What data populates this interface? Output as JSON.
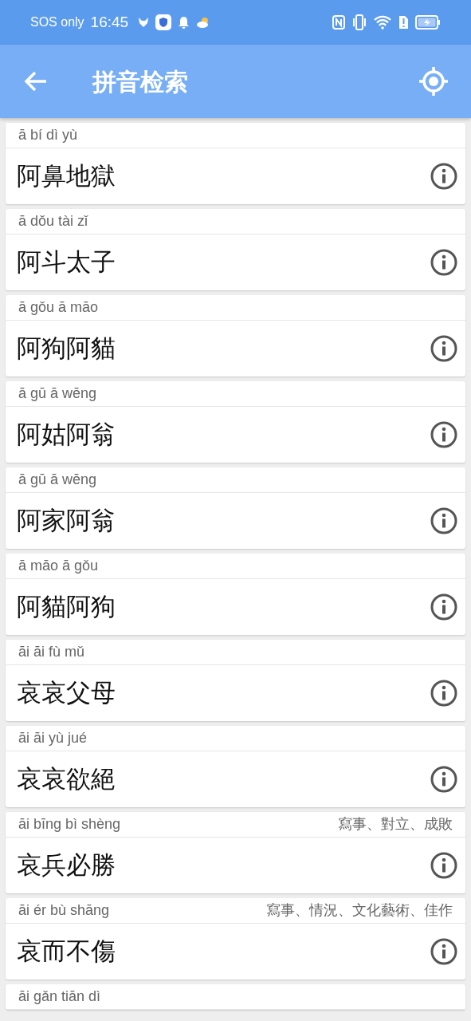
{
  "status_bar": {
    "carrier": "SOS only",
    "time": "16:45"
  },
  "app_bar": {
    "title": "拼音检索"
  },
  "entries": [
    {
      "pinyin": "ā bí dì yù",
      "phrase": "阿鼻地獄"
    },
    {
      "pinyin": "ā dǒu tài zǐ",
      "phrase": "阿斗太子"
    },
    {
      "pinyin": "ā gǒu ā māo",
      "phrase": "阿狗阿貓"
    },
    {
      "pinyin": "ā gū ā wēng",
      "phrase": "阿姑阿翁"
    },
    {
      "pinyin": "ā gū ā wēng",
      "phrase": "阿家阿翁"
    },
    {
      "pinyin": "ā māo ā gǒu",
      "phrase": "阿貓阿狗"
    },
    {
      "pinyin": "āi āi fù mǔ",
      "phrase": "哀哀父母"
    },
    {
      "pinyin": "āi āi yù jué",
      "phrase": "哀哀欲絕"
    },
    {
      "pinyin": "āi bīng bì shèng",
      "tags": "寫事、對立、成敗",
      "phrase": "哀兵必勝"
    },
    {
      "pinyin": "āi ér bù shāng",
      "tags": "寫事、情況、文化藝術、佳作",
      "phrase": "哀而不傷"
    },
    {
      "pinyin": "āi gǎn tiān dì"
    }
  ]
}
